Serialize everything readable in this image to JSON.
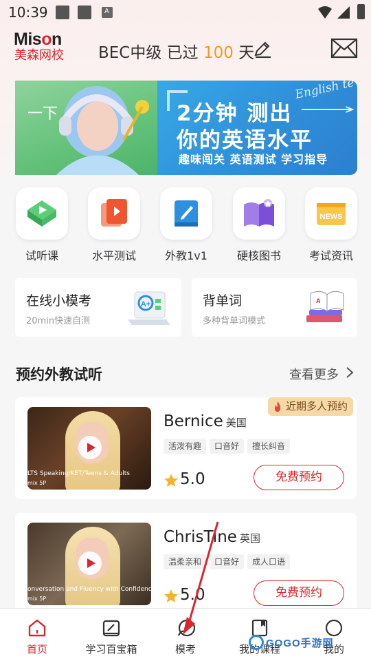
{
  "status_bar": {
    "time": "10:39"
  },
  "header": {
    "logo_en": "Mison",
    "logo_cn": "美森网校",
    "exam_prefix": "BEC中级 已过 ",
    "exam_days": "100",
    "exam_suffix": " 天"
  },
  "banner": {
    "left_label": "一下",
    "script_text": "English te",
    "headline1": "2分钟 测出",
    "headline2": "你的英语水平",
    "subline": "趣味闯关 英语测试 学习指导"
  },
  "quick_entries": [
    {
      "label": "试听课",
      "icon": "trial-class-icon",
      "color": "#4fc36b"
    },
    {
      "label": "水平测试",
      "icon": "level-test-icon",
      "color": "#f0552f"
    },
    {
      "label": "外教1v1",
      "icon": "foreign-teacher-icon",
      "color": "#2c8fe0"
    },
    {
      "label": "硬核图书",
      "icon": "books-icon",
      "color": "#8a5ce0"
    },
    {
      "label": "考试资讯",
      "icon": "exam-news-icon",
      "color": "#f3b42a"
    }
  ],
  "cards": {
    "mock": {
      "title": "在线小模考",
      "subtitle": "20min快速自测"
    },
    "words": {
      "title": "背单词",
      "subtitle": "多种背单词模式"
    }
  },
  "section": {
    "title": "预约外教试听",
    "more": "查看更多"
  },
  "teachers": [
    {
      "name": "Bernice",
      "nationality": "美国",
      "tags": [
        "活泼有趣",
        "口音好",
        "擅长纠音"
      ],
      "rating": "5.0",
      "book_label": "免费预约",
      "hot_badge": "近期多人预约",
      "video_caption": "LTS Speaking/KET/Teens & Adults",
      "video_caption2": "mix 5P"
    },
    {
      "name": "ChrisTine",
      "nationality": "英国",
      "tags": [
        "温柔亲和",
        "口音好",
        "成人口语"
      ],
      "rating": "5.0",
      "book_label": "免费预约",
      "video_caption": "onversation and Fluency with Confidence",
      "video_caption2": "mix 5P"
    }
  ],
  "bottom_nav": [
    {
      "label": "首页",
      "icon": "home-icon",
      "active": true
    },
    {
      "label": "学习百宝箱",
      "icon": "toolbox-icon",
      "active": false
    },
    {
      "label": "模考",
      "icon": "mock-exam-icon",
      "active": false
    },
    {
      "label": "我的课程",
      "icon": "my-courses-icon",
      "active": false
    },
    {
      "label": "我的",
      "icon": "profile-icon",
      "active": false
    }
  ],
  "watermark": "GOGO手游网"
}
